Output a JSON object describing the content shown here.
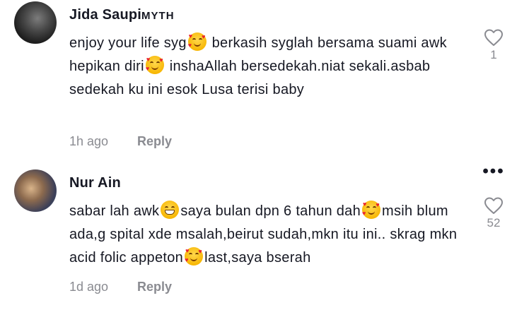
{
  "comments": [
    {
      "username": "Jida Saupi",
      "username_suffix": "MYTH",
      "text_parts": [
        "enjoy your life syg",
        " berkasih syglah bersama suami awk hepikan diri",
        " inshaAllah bersedekah.niat sekali.asbab sedekah ku ini esok Lusa terisi baby"
      ],
      "emojis": [
        "smiling-face-with-hearts",
        "smiling-face-with-hearts"
      ],
      "time": "1h ago",
      "reply_label": "Reply",
      "like_count": "1"
    },
    {
      "username": "Nur Ain",
      "text_parts": [
        "sabar lah awk",
        "saya bulan dpn 6 tahun dah",
        "msih blum ada,g spital xde msalah,beirut sudah,mkn itu ini.. skrag mkn acid folic appeton",
        "last,saya bserah"
      ],
      "emojis": [
        "grinning-face",
        "smiling-face-with-hearts",
        "smiling-face-with-hearts"
      ],
      "time": "1d ago",
      "reply_label": "Reply",
      "like_count": "52"
    }
  ],
  "more_icon": "ellipsis-icon",
  "like_icon": "heart-outline-icon",
  "colors": {
    "text": "#161823",
    "muted": "#8a8b91",
    "emoji_heart": "#e8232f"
  }
}
